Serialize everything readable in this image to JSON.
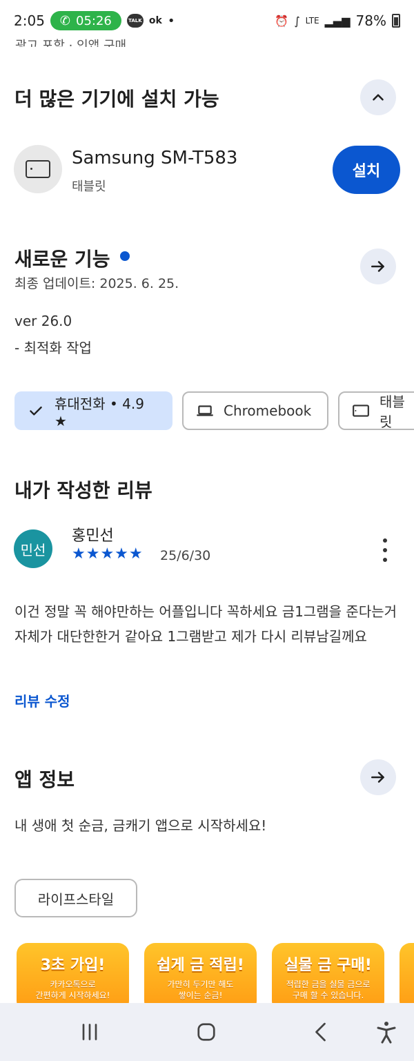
{
  "status_bar": {
    "time": "2:05",
    "call_timer": "05:26",
    "talk_label": "TALK",
    "ok_label": "ok",
    "dot": "•",
    "network_label": "LTE",
    "battery": "78%"
  },
  "top_cut_text": "광고 포함 · 인앱 구매",
  "devices_section": {
    "title": "더 많은 기기에 설치 가능",
    "device_name": "Samsung SM-T583",
    "device_type": "태블릿",
    "install_label": "설치"
  },
  "whats_new": {
    "title": "새로운 기능",
    "updated": "최종 업데이트: 2025. 6. 25.",
    "version": "ver 26.0",
    "note": "- 최적화 작업"
  },
  "device_chips": [
    {
      "label": "휴대전화 • 4.9 ★",
      "selected": true,
      "icon": "check-icon"
    },
    {
      "label": "Chromebook",
      "selected": false,
      "icon": "laptop-icon"
    },
    {
      "label": "태블릿",
      "selected": false,
      "icon": "tablet-icon"
    }
  ],
  "my_review": {
    "title": "내가 작성한 리뷰",
    "avatar_text": "민선",
    "reviewer": "홍민선",
    "stars": "★★★★★",
    "rating": 5,
    "date": "25/6/30",
    "text": "이건 정말 꼭 해야만하는 어플입니다 꼭하세요 금1그램을 준다는거자체가 대단한한거 같아요 1그램받고 제가 다시 리뷰남길께요",
    "edit_label": "리뷰 수정"
  },
  "app_info": {
    "title": "앱 정보",
    "description": "내 생애 첫 순금, 금캐기 앱으로 시작하세요!",
    "category": "라이프스타일"
  },
  "promo_cards": [
    {
      "title": "3초 가입!",
      "sub1": "카카오톡으로",
      "sub2": "간편하게 시작하세요!"
    },
    {
      "title": "쉽게 금 적립!",
      "sub1": "가만히 두기만 해도",
      "sub2": "쌓이는 순금!"
    },
    {
      "title": "실물 금 구매!",
      "sub1": "적립한 금을 실물 금으로",
      "sub2": "구매 할 수 있습니다."
    }
  ],
  "colors": {
    "accent": "#0b57d0",
    "chip_selected_bg": "#d3e3fd",
    "round_button_bg": "#e8ecf5",
    "call_green": "#2eb34a",
    "avatar_teal": "#1a94a0",
    "promo_orange": "#ff9b13"
  }
}
